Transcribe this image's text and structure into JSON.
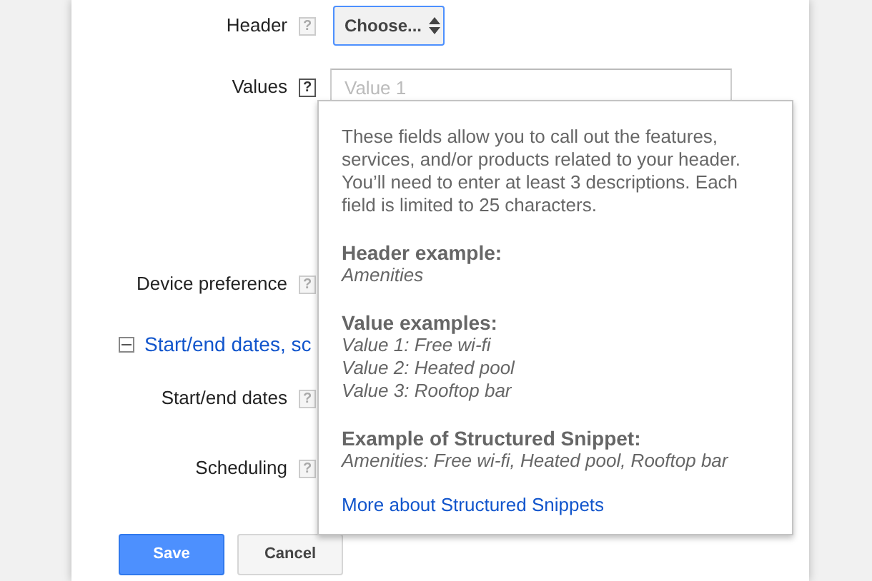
{
  "form": {
    "rows": [
      {
        "kind": "select",
        "label": "Header",
        "help": "?",
        "help_active": false,
        "value": "Choose...",
        "focused": true
      },
      {
        "kind": "input",
        "label": "Values",
        "help": "?",
        "help_active": true,
        "placeholder": "Value 1"
      },
      {
        "kind": "plain",
        "label": "Device preference",
        "help": "?",
        "help_active": false
      },
      {
        "kind": "section",
        "label": "Start/end dates, sc",
        "expanded": true
      },
      {
        "kind": "plain",
        "label": "Start/end dates",
        "help": "?",
        "help_active": false
      },
      {
        "kind": "plain",
        "label": "Scheduling",
        "help": "?",
        "help_active": false
      }
    ]
  },
  "buttons": [
    {
      "label": "Save",
      "kind": "primary"
    },
    {
      "label": "Cancel",
      "kind": "secondary"
    }
  ],
  "tooltip": {
    "intro": "These fields allow you to call out the features, services, and/or products related to your header. You’ll need to enter at least 3 descriptions. Each field is limited to 25 characters.",
    "sections": [
      {
        "heading": "Header example:",
        "lines": [
          "Amenities"
        ]
      },
      {
        "heading": "Value examples:",
        "lines": [
          "Value 1: Free wi-fi",
          "Value 2: Heated pool",
          "Value 3: Rooftop bar"
        ]
      },
      {
        "heading": "Example of Structured Snippet:",
        "lines": [
          "Amenities: Free wi-fi, Heated pool, Rooftop bar"
        ]
      }
    ],
    "link": "More about Structured Snippets"
  }
}
